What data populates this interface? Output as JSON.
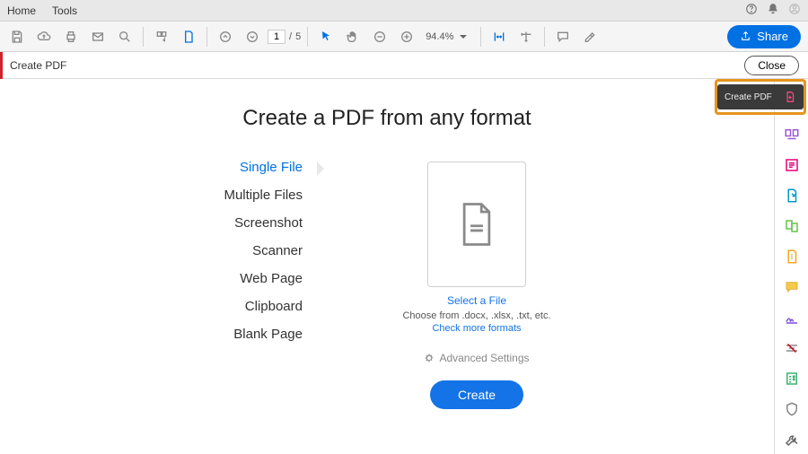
{
  "menubar": {
    "home": "Home",
    "tools": "Tools"
  },
  "toolbar": {
    "page_current": "1",
    "page_sep": "/",
    "page_total": "5",
    "zoom": "94.4%",
    "share": "Share"
  },
  "subheader": {
    "title": "Create PDF",
    "close": "Close"
  },
  "main": {
    "heading": "Create a PDF from any format",
    "options": [
      "Single File",
      "Multiple Files",
      "Screenshot",
      "Scanner",
      "Web Page",
      "Clipboard",
      "Blank Page"
    ],
    "select_file": "Select a File",
    "hint": "Choose from .docx, .xlsx, .txt, etc.",
    "check_more": "Check more formats",
    "advanced": "Advanced Settings",
    "create": "Create"
  },
  "callout": {
    "label": "Create PDF"
  }
}
